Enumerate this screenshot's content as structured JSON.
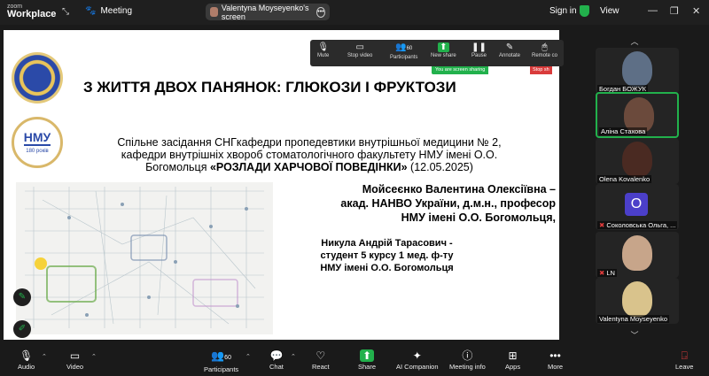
{
  "topbar": {
    "logo_top": "zoom",
    "logo_bottom": "Workplace",
    "meeting_label": "Meeting",
    "share_label": "Valentyna Moyseyenko's screen",
    "signin": "Sign in",
    "view": "View"
  },
  "slide": {
    "title": "З ЖИТТЯ ДВОХ ПАНЯНОК: ГЛЮКОЗИ І ФРУКТОЗИ",
    "subtitle_line1": "Спільне засідання СНГкафедри пропедевтики внутрішньої медицини № 2,",
    "subtitle_line2": "кафедри внутрішніх хвороб стоматологічного факультету НМУ імені О.О.",
    "subtitle_line3_a": "Богомольця ",
    "subtitle_line3_b": "«РОЗЛАДИ ХАРЧОВОЇ ПОВЕДІНКИ»",
    "subtitle_line3_c": " (12.05.2025)",
    "author1_line1": "Мойсеєнко Валентина Олексіївна –",
    "author1_line2": "акад. НАНВО України, д.м.н., професор",
    "author1_line3": "НМУ імені О.О. Богомольця,",
    "author2_line1": "Никула Андрій Тарасович -",
    "author2_line2": "студент 5 курсу 1 мед. ф-ту",
    "author2_line3": "НМУ імені О.О. Богомольця",
    "nmu_text": "НМУ",
    "nmu_year": "180 років"
  },
  "share_toolbar": {
    "mute": "Mute",
    "stop_video": "Stop video",
    "participants": "Participants",
    "participants_count": "60",
    "new_share": "New share",
    "pause": "Pause",
    "annotate": "Annotate",
    "remote": "Remote co",
    "sharing_note": "You are screen sharing",
    "stop_note": "Stop sh"
  },
  "gallery": [
    {
      "name": "Богдан БОЖУК"
    },
    {
      "name": "Аліна Стахова"
    },
    {
      "name": "Olena Kovalenko"
    },
    {
      "name": "Соколовська Ольга, ...",
      "letter": "О"
    },
    {
      "name": "LN"
    },
    {
      "name": "Valentyna Moyseyenko"
    }
  ],
  "bottombar": {
    "audio": "Audio",
    "video": "Video",
    "participants": "Participants",
    "participants_count": "60",
    "chat": "Chat",
    "react": "React",
    "share": "Share",
    "ai": "AI Companion",
    "info": "Meeting info",
    "apps": "Apps",
    "more": "More",
    "leave": "Leave"
  }
}
